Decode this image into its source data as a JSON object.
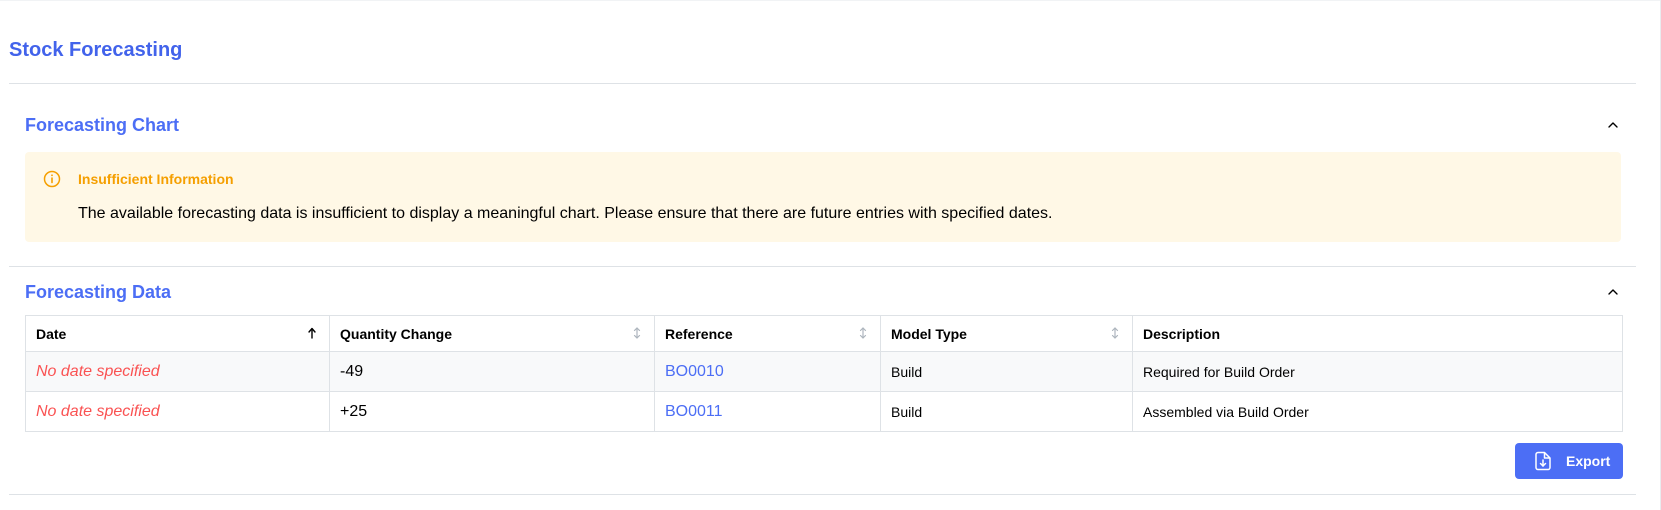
{
  "page": {
    "title": "Stock Forecasting"
  },
  "chart_section": {
    "title": "Forecasting Chart",
    "alert": {
      "title": "Insufficient Information",
      "message": "The available forecasting data is insufficient to display a meaningful chart. Please ensure that there are future entries with specified dates."
    }
  },
  "data_section": {
    "title": "Forecasting Data",
    "columns": [
      "Date",
      "Quantity Change",
      "Reference",
      "Model Type",
      "Description"
    ],
    "rows": [
      {
        "date": "No date specified",
        "quantity_change": "-49",
        "reference": "BO0010",
        "model_type": "Build",
        "description": "Required for Build Order"
      },
      {
        "date": "No date specified",
        "quantity_change": "+25",
        "reference": "BO0011",
        "model_type": "Build",
        "description": "Assembled via Build Order"
      }
    ],
    "sort": {
      "column": "Date",
      "direction": "ascending"
    },
    "export_label": "Export"
  },
  "colors": {
    "accent": "#4c6ef5",
    "title": "#4263eb",
    "warning": "#f59f00",
    "warning_bg": "#fff8e6",
    "missing_date": "#fa5252"
  },
  "icons": {
    "alert": "info-circle-icon",
    "collapse": "chevron-up-icon",
    "sort_active": "arrow-up-icon",
    "sort_inactive": "sort-arrows-icon",
    "export": "file-download-icon"
  }
}
